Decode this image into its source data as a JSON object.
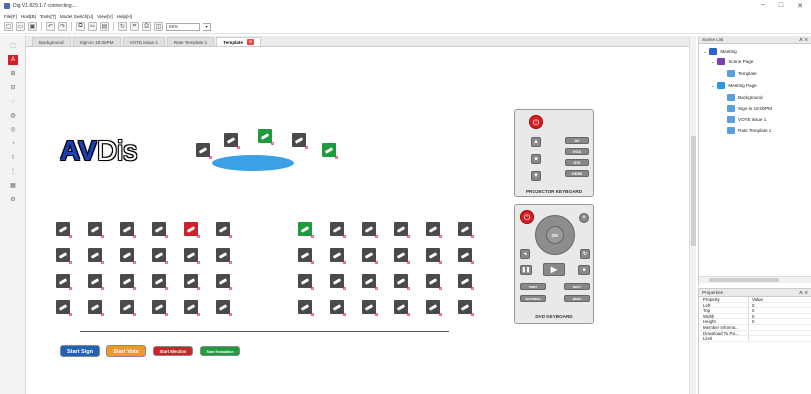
{
  "window": {
    "title": "Dig V1.829.1.7 connecting....",
    "controls": [
      "−",
      "□",
      "✕"
    ]
  },
  "menu": [
    "File[F]",
    "Host[B]",
    "Tools[T]",
    "Model Switch[U]",
    "View[V]",
    "Help[H]"
  ],
  "toolbar": {
    "zoom_value": "89%",
    "zoom_arrow": "▾",
    "buttons": [
      "new-icon",
      "open-icon",
      "save-icon",
      "undo-icon",
      "redo-icon",
      "copy-icon",
      "cut-icon",
      "paste-icon",
      "refresh-icon",
      "fit-icon",
      "print-icon",
      "preview-icon"
    ]
  },
  "tabs": [
    {
      "label": "Background",
      "active": false
    },
    {
      "label": "Sign-in 19:00PM",
      "active": false
    },
    {
      "label": "VOTE issue 1",
      "active": false
    },
    {
      "label": "Rate Template 1",
      "active": false
    },
    {
      "label": "Template",
      "active": true
    }
  ],
  "tab_close": "✕",
  "canvas": {
    "logo_left": "AV",
    "logo_right": "Dis",
    "buttons": {
      "start_sign": "Start Sign",
      "start_vote": "Start Vote",
      "start_election": "Start Election",
      "start_evaluation": "Start Evaluation"
    }
  },
  "projector": {
    "label": "PROJECTOR KEYBOARD",
    "power": "⏻",
    "keys": [
      "AV",
      "VGA",
      "DVI",
      "HDMI"
    ]
  },
  "dvd": {
    "label": "DVD KEYBOARD",
    "power": "⏻",
    "ok": "OK",
    "small_keys": [
      "PREV",
      "NEXT",
      "SETTINGS",
      "MENU"
    ]
  },
  "scene_list": {
    "title": "Scene List",
    "pin": "ᗑ ✕",
    "items": [
      {
        "label": "Meeting",
        "level": 0,
        "color": "#2a66c8"
      },
      {
        "label": "Scene Page",
        "level": 1,
        "color": "#7a3fb0"
      },
      {
        "label": "Template",
        "level": 2,
        "color": "#5aa0e0"
      },
      {
        "label": "Meeting Page",
        "level": 1,
        "color": "#2a9ae6"
      },
      {
        "label": "Background",
        "level": 2,
        "color": "#5aa0e0"
      },
      {
        "label": "Sign-in 19:00PM",
        "level": 2,
        "color": "#5aa0e0"
      },
      {
        "label": "VOTE issue 1",
        "level": 2,
        "color": "#5aa0e0"
      },
      {
        "label": "Rate Template 1",
        "level": 2,
        "color": "#5aa0e0"
      }
    ]
  },
  "properties": {
    "title": "Properties",
    "pin": "ᗑ ✕",
    "header": {
      "k": "Property",
      "v": "Value"
    },
    "rows": [
      {
        "k": "Left",
        "v": "0"
      },
      {
        "k": "Top",
        "v": "0"
      },
      {
        "k": "Width",
        "v": "0"
      },
      {
        "k": "Height",
        "v": "0"
      },
      {
        "k": "Member Informa...",
        "v": ""
      },
      {
        "k": "Download To Pa...",
        "v": ""
      },
      {
        "k": "Limit",
        "v": ""
      }
    ]
  },
  "colors": {
    "start_sign": "#1f62b8",
    "start_vote": "#f29a1f",
    "start_election": "#d2202a",
    "start_evaluation": "#1f9a3e",
    "stage": "#3aa1e6"
  }
}
